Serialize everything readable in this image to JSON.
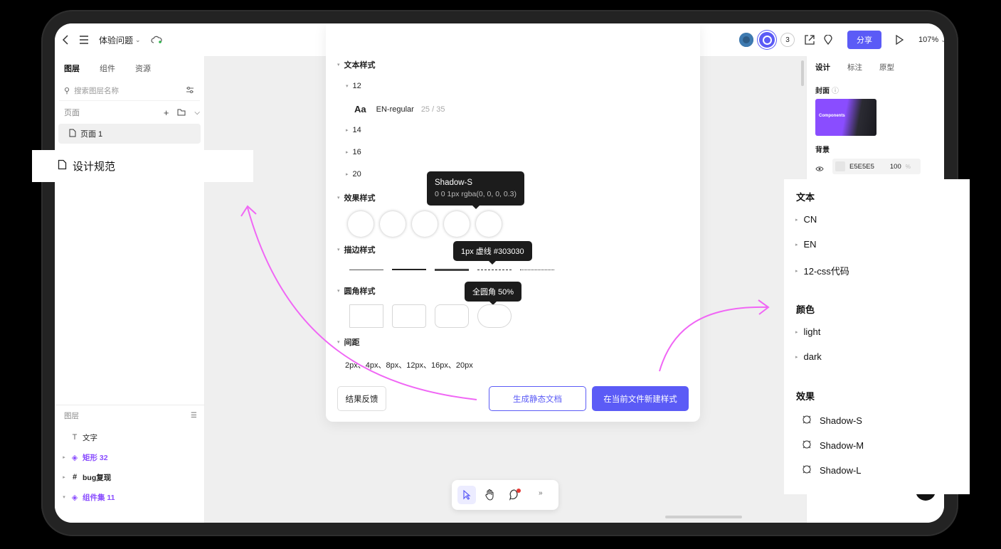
{
  "topbar": {
    "file_name": "体验问题",
    "collaborator_count": "3",
    "share_label": "分享",
    "zoom": "107%"
  },
  "left_panel": {
    "tabs": [
      "图层",
      "组件",
      "资源"
    ],
    "search_placeholder": "搜索图层名称",
    "pages_label": "页面",
    "page_item": "页面 1",
    "layers_label": "图层",
    "layers": [
      {
        "name": "文字",
        "icon": "text-icon"
      },
      {
        "name": "矩形 32",
        "icon": "component-icon"
      },
      {
        "name": "bug复现",
        "icon": "frame-icon"
      },
      {
        "name": "组件集 11",
        "icon": "component-icon"
      }
    ]
  },
  "callout_left": {
    "label": "设计规范"
  },
  "dialog": {
    "text_styles_label": "文本样式",
    "size_12": "12",
    "font_sample": "Aa",
    "font_name": "EN-regular",
    "font_metrics": "25 / 35",
    "size_14": "14",
    "size_16": "16",
    "size_20": "20",
    "effect_styles_label": "效果样式",
    "tooltip_shadow_title": "Shadow-S",
    "tooltip_shadow_value": "0 0 1px rgba(0,  0,  0,  0.3)",
    "stroke_styles_label": "描边样式",
    "tooltip_stroke": "1px 虚线 #303030",
    "radius_styles_label": "圆角样式",
    "tooltip_radius": "全圆角 50%",
    "spacing_label": "间距",
    "spacing_values": "2px、4px、8px、12px、16px、20px",
    "feedback_button": "结果反馈",
    "generate_doc_button": "生成静态文档",
    "create_styles_button": "在当前文件新建样式"
  },
  "right_panel": {
    "tabs": [
      "设计",
      "标注",
      "原型"
    ],
    "cover_label": "封面",
    "cover_title": "Components",
    "background_label": "背景",
    "bg_hex": "E5E5E5",
    "bg_opacity": "100",
    "bg_percent": "%"
  },
  "callout_right": {
    "text_heading": "文本",
    "text_items": [
      "CN",
      "EN",
      "12-css代码"
    ],
    "color_heading": "颜色",
    "color_items": [
      "light",
      "dark"
    ],
    "effect_heading": "效果",
    "effect_items": [
      "Shadow-S",
      "Shadow-M",
      "Shadow-L"
    ]
  },
  "colors": {
    "accent": "#5b5bf6",
    "arrow": "#f066f5",
    "component_purple": "#8a4dff"
  }
}
